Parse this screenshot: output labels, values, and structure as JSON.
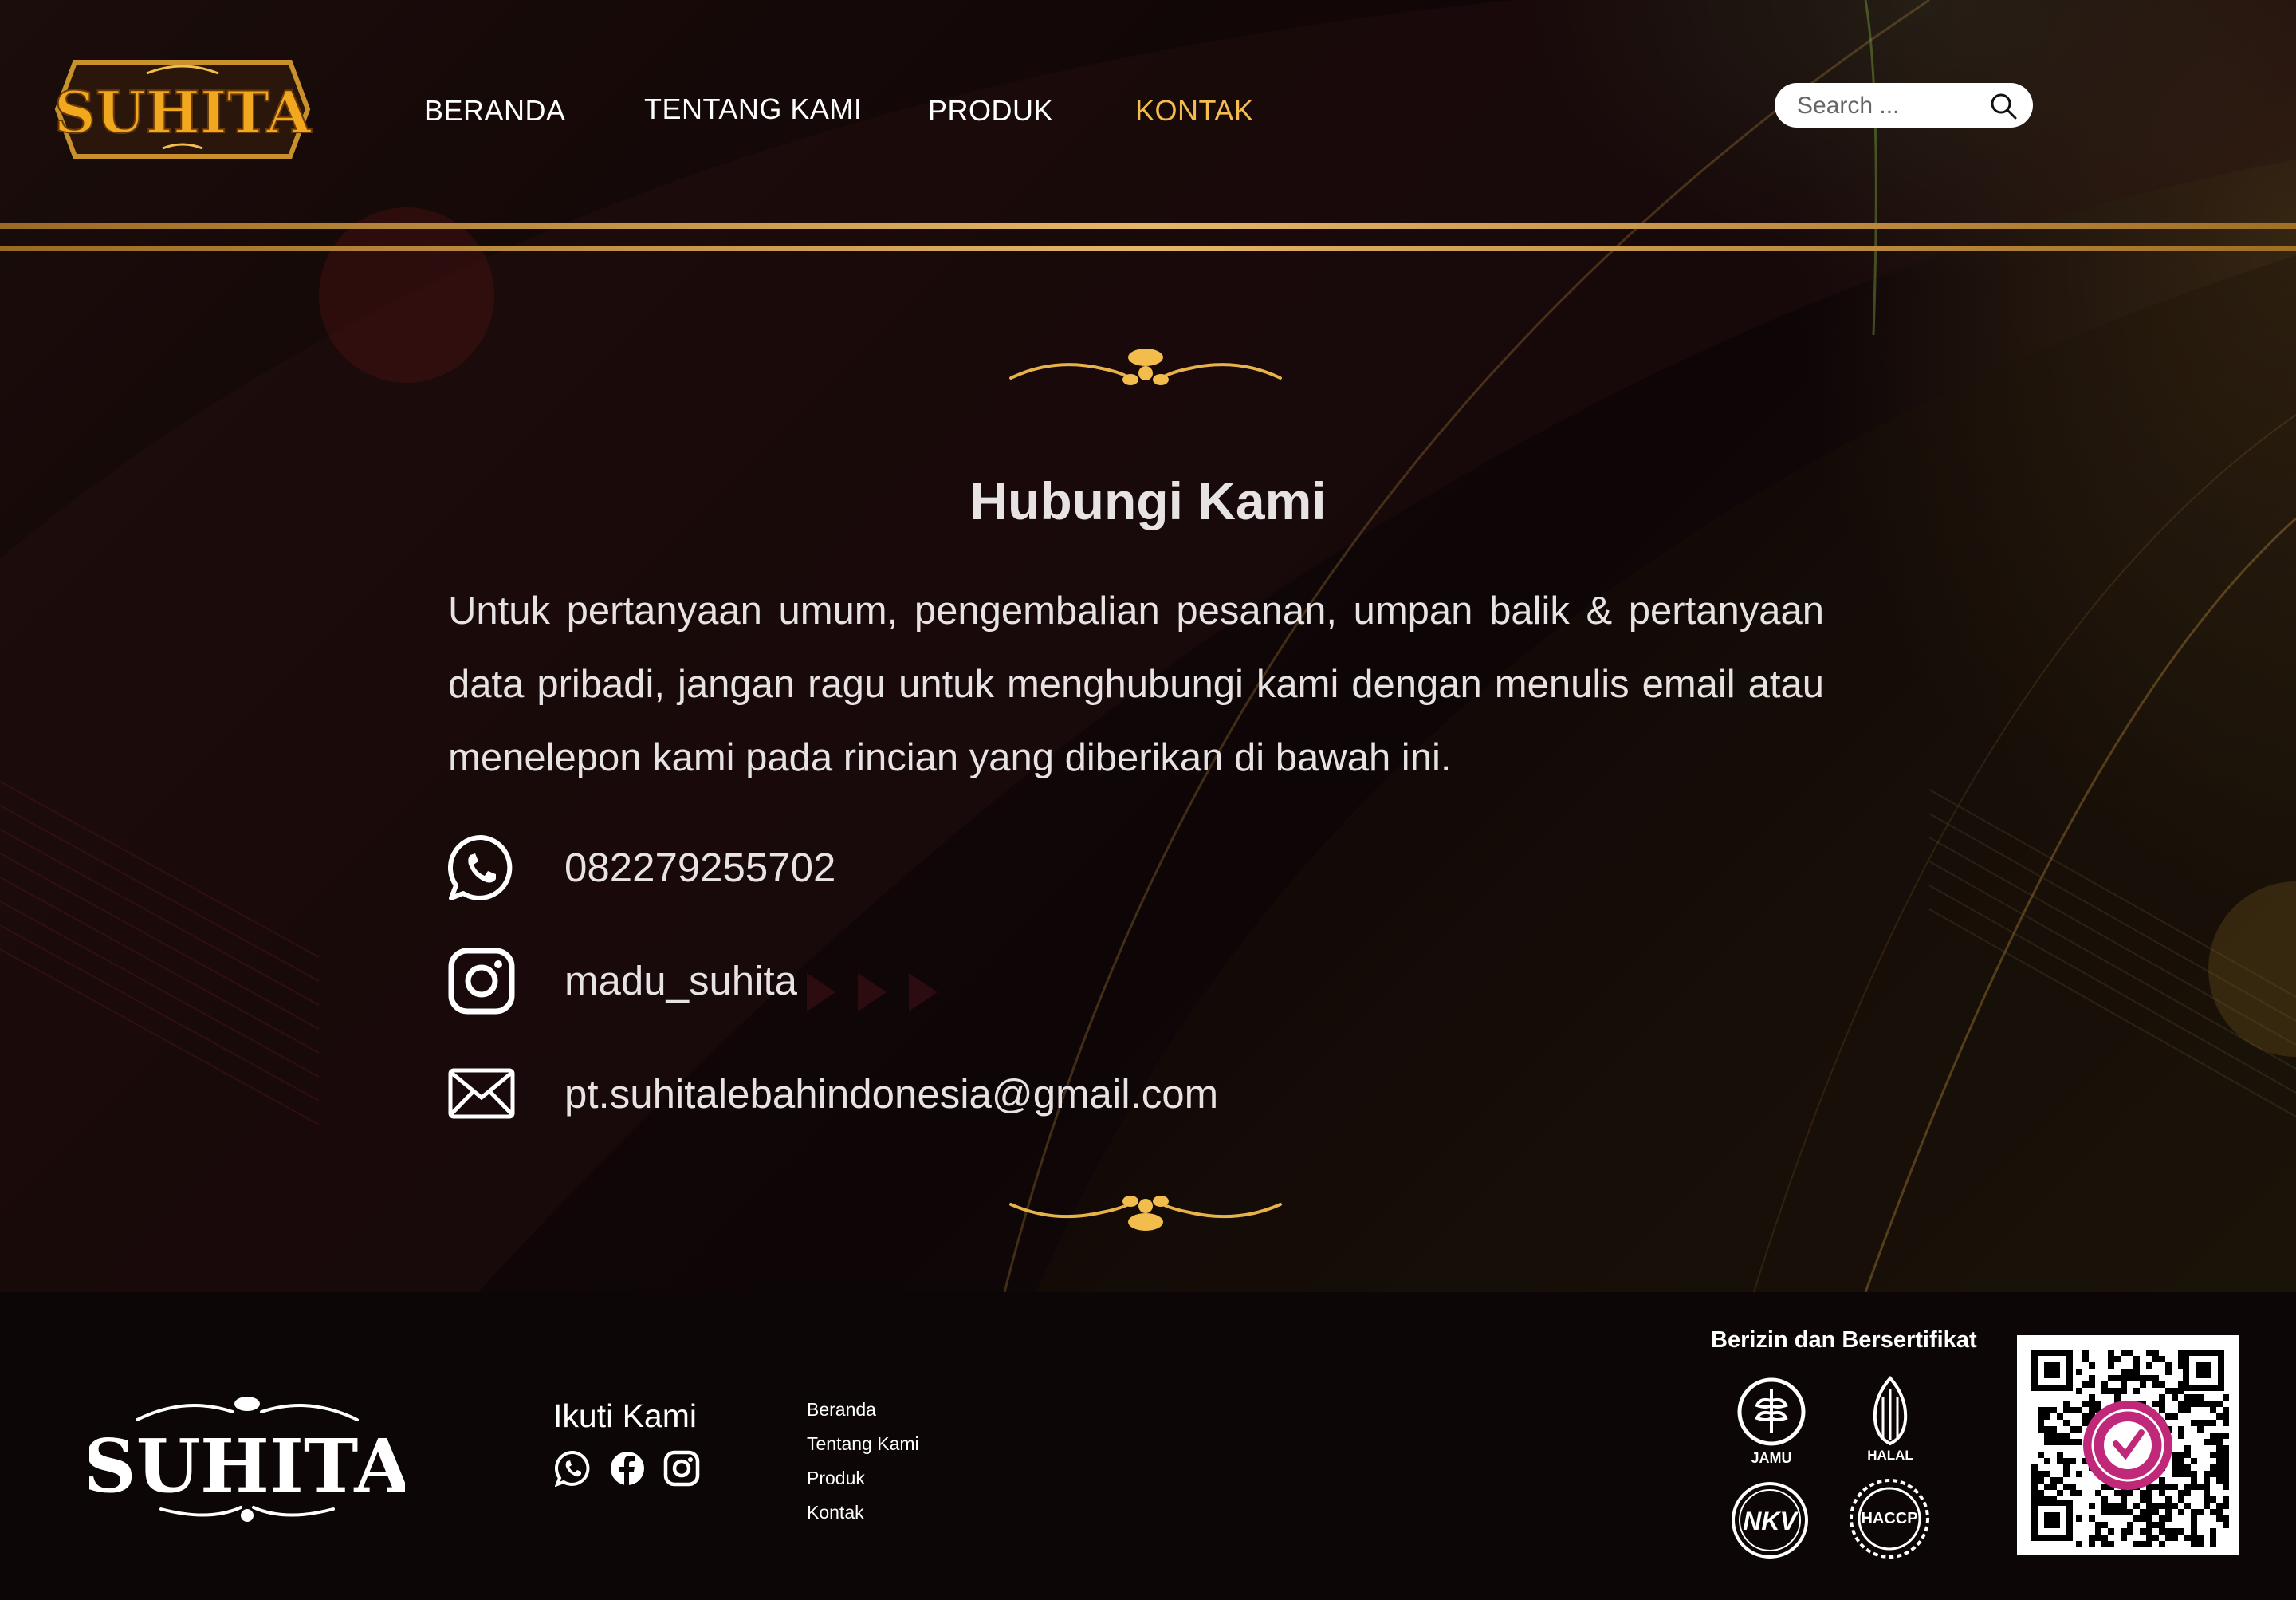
{
  "brand": {
    "name": "SUHITA"
  },
  "nav": {
    "items": [
      {
        "label": "BERANDA"
      },
      {
        "label": "TENTANG KAMI"
      },
      {
        "label": "PRODUK"
      },
      {
        "label": "KONTAK",
        "active": true
      }
    ]
  },
  "search": {
    "placeholder": "Search ..."
  },
  "contact": {
    "title": "Hubungi Kami",
    "intro": "Untuk pertanyaan umum, pengembalian pesanan, umpan balik & pertanyaan data pribadi, jangan ragu untuk menghubungi kami dengan menulis email atau menelepon kami pada rincian yang diberikan di bawah ini.",
    "items": [
      {
        "icon": "whatsapp-icon",
        "value": "082279255702"
      },
      {
        "icon": "instagram-icon",
        "value": "madu_suhita"
      },
      {
        "icon": "email-icon",
        "value": "pt.suhitalebahindonesia@gmail.com"
      }
    ]
  },
  "footer": {
    "follow_title": "Ikuti Kami",
    "social": [
      "whatsapp-icon",
      "facebook-icon",
      "instagram-icon"
    ],
    "links": [
      "Beranda",
      "Tentang Kami",
      "Produk",
      "Kontak"
    ],
    "certified_title": "Berizin dan Bersertifikat",
    "certs": [
      "JAMU",
      "HALAL",
      "NKV",
      "HACCP"
    ]
  },
  "colors": {
    "accent": "#f2bd4c",
    "gold": "#c8912b",
    "background": "#0b0506"
  }
}
